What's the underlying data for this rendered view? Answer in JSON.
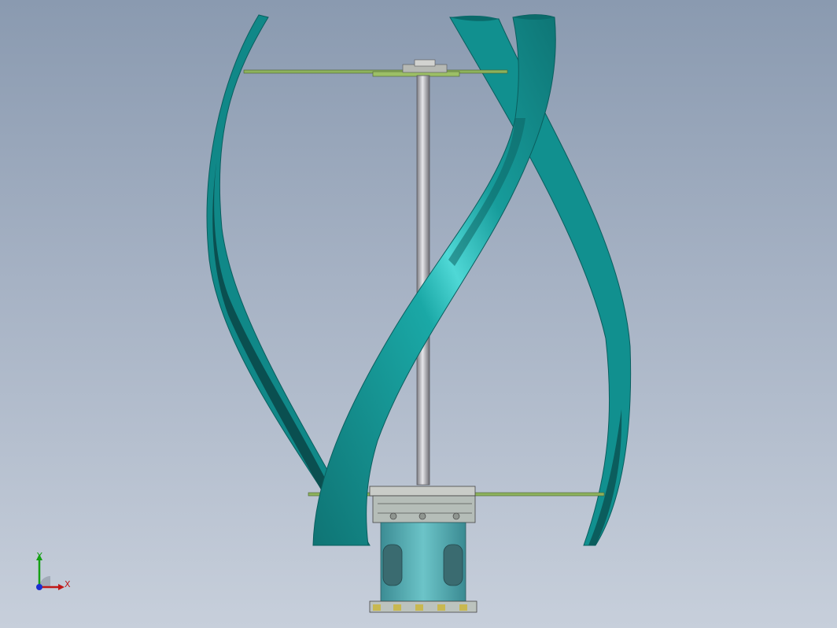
{
  "view": {
    "background_top": "#8a9ab0",
    "background_bottom": "#c7cfdb"
  },
  "model": {
    "blade_color": "#12898a",
    "shaft_color": "#a9a9ad",
    "strut_color": "#8db25c",
    "generator_color": "#58aeb4"
  },
  "triad": {
    "x_label": "X",
    "y_label": "Y",
    "x_color": "#c01818",
    "y_color": "#14a014",
    "z_color": "#1a2fd0"
  }
}
